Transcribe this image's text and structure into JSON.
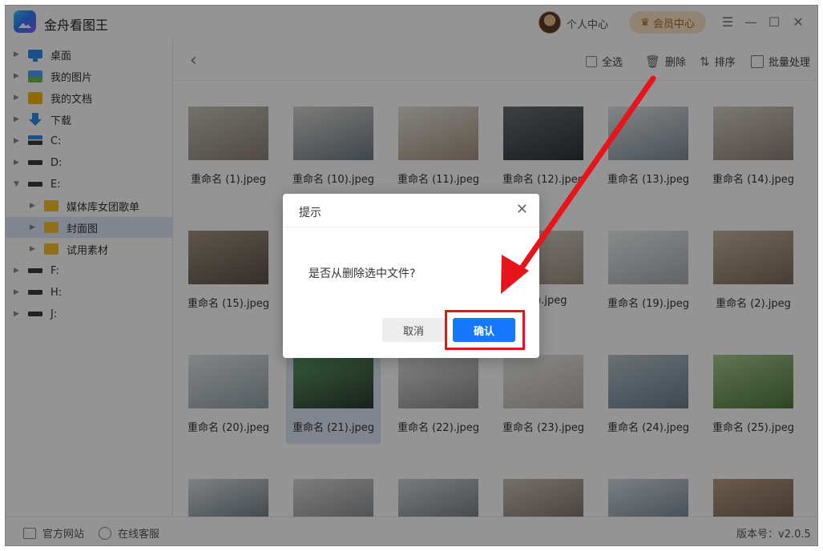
{
  "app": {
    "title": "金舟看图王"
  },
  "titlebar": {
    "user_center": "个人中心",
    "vip_label": "会员中心",
    "menu_icon": "menu-icon",
    "minimize_icon": "minimize-icon",
    "maximize_icon": "maximize-icon",
    "close_icon": "close-icon"
  },
  "sidebar": {
    "items": [
      {
        "label": "桌面",
        "icon": "desktop-icon"
      },
      {
        "label": "我的图片",
        "icon": "picture-icon"
      },
      {
        "label": "我的文档",
        "icon": "document-folder-icon"
      },
      {
        "label": "下载",
        "icon": "download-icon"
      },
      {
        "label": "C:",
        "icon": "drive-icon"
      },
      {
        "label": "D:",
        "icon": "drive-icon"
      },
      {
        "label": "E:",
        "icon": "drive-icon"
      },
      {
        "label": "媒体库女团歌单",
        "icon": "folder-icon"
      },
      {
        "label": "封面图",
        "icon": "folder-icon"
      },
      {
        "label": "试用素材",
        "icon": "folder-icon"
      },
      {
        "label": "F:",
        "icon": "drive-icon"
      },
      {
        "label": "H:",
        "icon": "drive-icon"
      },
      {
        "label": "J:",
        "icon": "drive-icon"
      }
    ]
  },
  "toolbar": {
    "select_all": "全选",
    "delete": "删除",
    "sort": "排序",
    "batch": "批量处理"
  },
  "thumbnails": [
    {
      "name": "重命名 (1).jpeg"
    },
    {
      "name": "重命名 (10).jpeg"
    },
    {
      "name": "重命名 (11).jpeg"
    },
    {
      "name": "重命名 (12).jpeg"
    },
    {
      "name": "重命名 (13).jpeg"
    },
    {
      "name": "重命名 (14).jpeg"
    },
    {
      "name": "重命名 (15).jpeg"
    },
    {
      "name": ""
    },
    {
      "name": ""
    },
    {
      "name": "(18).jpeg"
    },
    {
      "name": "重命名 (19).jpeg"
    },
    {
      "name": "重命名 (2).jpeg"
    },
    {
      "name": "重命名 (20).jpeg"
    },
    {
      "name": "重命名 (21).jpeg"
    },
    {
      "name": "重命名 (22).jpeg"
    },
    {
      "name": "重命名 (23).jpeg"
    },
    {
      "name": "重命名 (24).jpeg"
    },
    {
      "name": "重命名 (25).jpeg"
    },
    {
      "name": ""
    },
    {
      "name": ""
    },
    {
      "name": ""
    },
    {
      "name": ""
    },
    {
      "name": ""
    },
    {
      "name": ""
    }
  ],
  "footer": {
    "website": "官方网站",
    "support": "在线客服",
    "version": "版本号：v2.0.5"
  },
  "dialog": {
    "title": "提示",
    "message": "是否从删除选中文件?",
    "cancel": "取消",
    "confirm": "确认"
  },
  "colors": {
    "accent": "#1677ff",
    "highlight": "#e8141b",
    "selection": "#dde8f8"
  }
}
